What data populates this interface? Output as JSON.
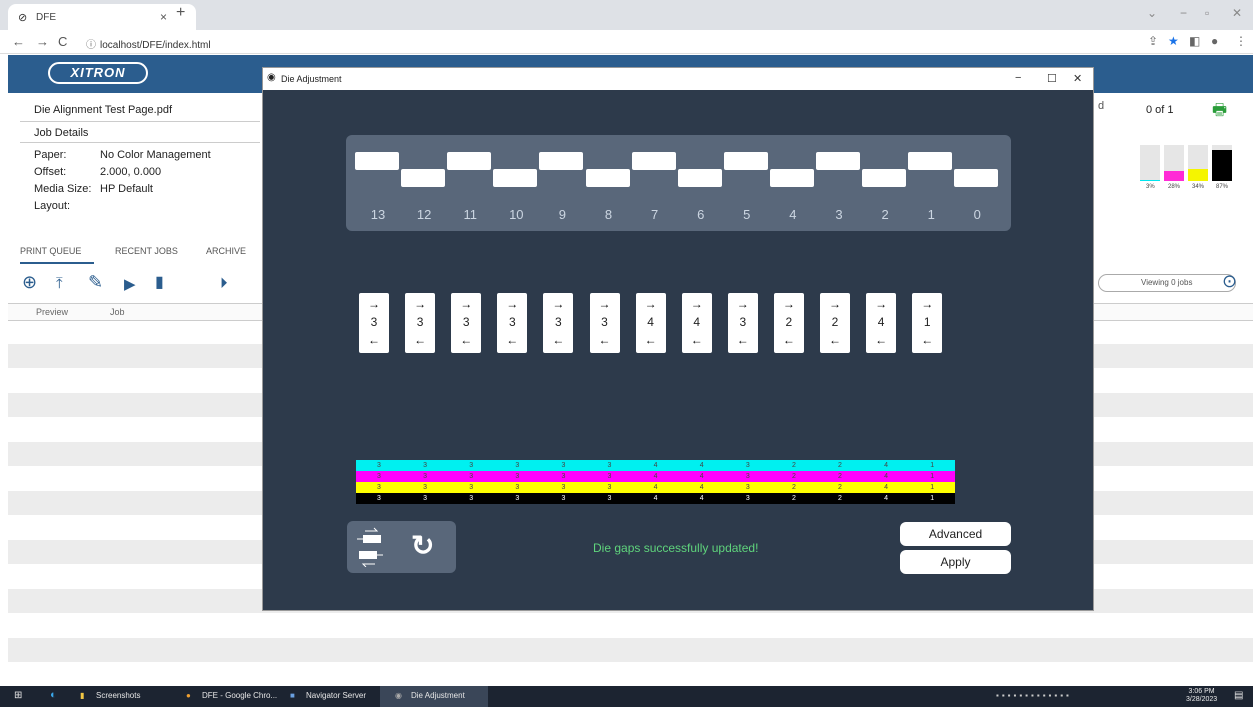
{
  "browser": {
    "tab_title": "DFE",
    "url": "localhost/DFE/index.html"
  },
  "app": {
    "logo_text": "XITRON",
    "job_name": "Die Alignment Test Page.pdf",
    "job_details_label": "Job Details",
    "details": [
      {
        "label": "Paper:",
        "value": "No Color Management"
      },
      {
        "label": "Offset:",
        "value": "2.000, 0.000"
      },
      {
        "label": "Media Size:",
        "value": "HP Default"
      },
      {
        "label": "Layout:",
        "value": ""
      }
    ],
    "tabs": [
      "PRINT QUEUE",
      "RECENT JOBS",
      "ARCHIVE"
    ],
    "columns": [
      "Preview",
      "Job"
    ],
    "page_info": "0 of 1",
    "partial_label": "d",
    "viewing_text": "Viewing 0 jobs",
    "ink_levels": [
      {
        "label": "3%",
        "value": 3,
        "color": "#00e5ee"
      },
      {
        "label": "28%",
        "value": 28,
        "color": "#ff2bd6"
      },
      {
        "label": "34%",
        "value": 34,
        "color": "#f5f500"
      },
      {
        "label": "87%",
        "value": 87,
        "color": "#000000"
      }
    ]
  },
  "modal": {
    "title": "Die Adjustment",
    "die_labels": [
      "13",
      "12",
      "11",
      "10",
      "9",
      "8",
      "7",
      "6",
      "5",
      "4",
      "3",
      "2",
      "1",
      "0"
    ],
    "gap_values": [
      "3",
      "3",
      "3",
      "3",
      "3",
      "3",
      "4",
      "4",
      "3",
      "2",
      "2",
      "4",
      "1"
    ],
    "arrow_right": "→",
    "arrow_left": "←",
    "strip_colors": [
      "#00f0f0",
      "#ff00ff",
      "#ffff00",
      "#000000"
    ],
    "message": "Die gaps successfully updated!",
    "advanced_label": "Advanced",
    "apply_label": "Apply"
  },
  "taskbar": {
    "items": [
      "Screenshots",
      "DFE - Google Chro...",
      "Navigator Server",
      "Die Adjustment"
    ],
    "time": "3:06 PM",
    "date": "3/28/2023"
  }
}
